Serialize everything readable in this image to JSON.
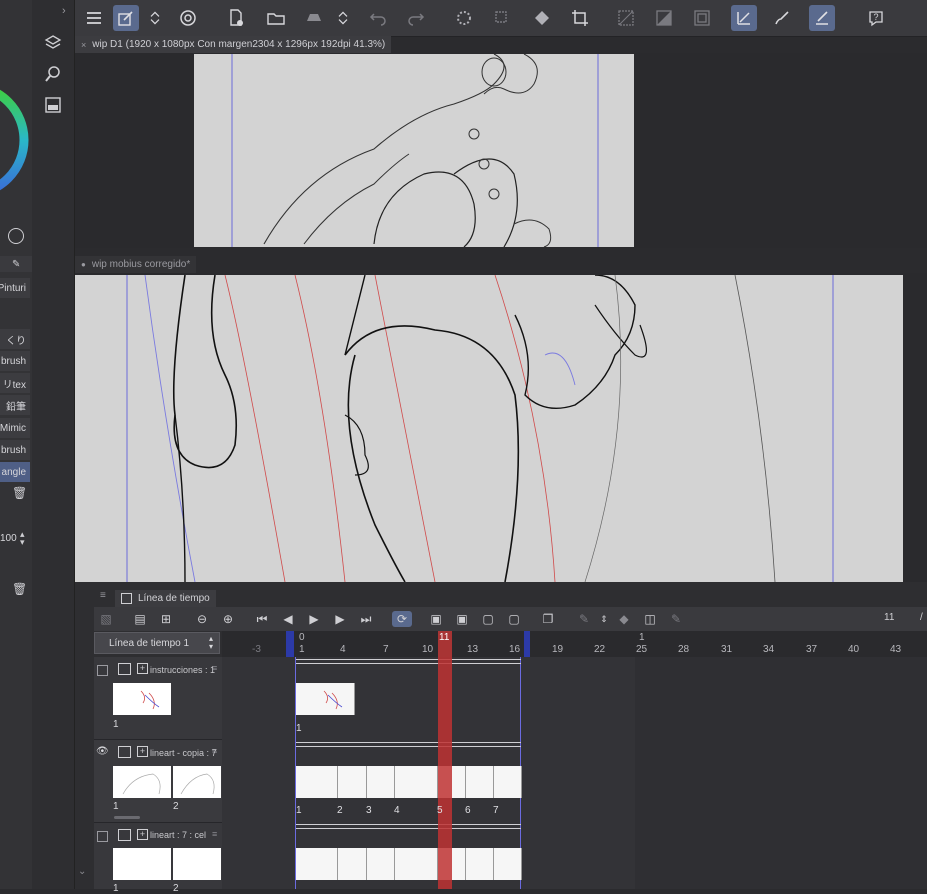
{
  "doc1": {
    "title": "wip D1 (1920 x 1080px Con margen2304 x 1296px 192dpi 41.3%)"
  },
  "doc2": {
    "title": "wip mobius corregido*"
  },
  "left_panel": {
    "items": [
      "Pinturi",
      "くり",
      "brush",
      "リtex",
      "鉛筆",
      "Mimic",
      "brush",
      "angle"
    ],
    "opacity": "100"
  },
  "timeline": {
    "tab_label": "Línea de tiempo",
    "select_value": "Línea de tiempo 1",
    "current_frame_display": "11",
    "slash": "/",
    "ruler_top": {
      "start": "0",
      "playhead": "11",
      "second": "1"
    },
    "ruler_numbers": [
      "-3",
      "1",
      "4",
      "7",
      "10",
      "13",
      "16",
      "19",
      "22",
      "25",
      "28",
      "31",
      "34",
      "37",
      "40",
      "43"
    ],
    "tracks": [
      {
        "name": "instrucciones : 1",
        "thumb_labels": [
          "1"
        ],
        "frame_labels": [
          "1"
        ]
      },
      {
        "name": "lineart - copia : 7",
        "thumb_labels": [
          "1",
          "2"
        ],
        "frame_labels": [
          "1",
          "2",
          "3",
          "4",
          "5",
          "6",
          "7"
        ]
      },
      {
        "name": "lineart : 7 : cel",
        "thumb_labels": [
          "1",
          "2"
        ],
        "frame_labels": []
      }
    ]
  }
}
